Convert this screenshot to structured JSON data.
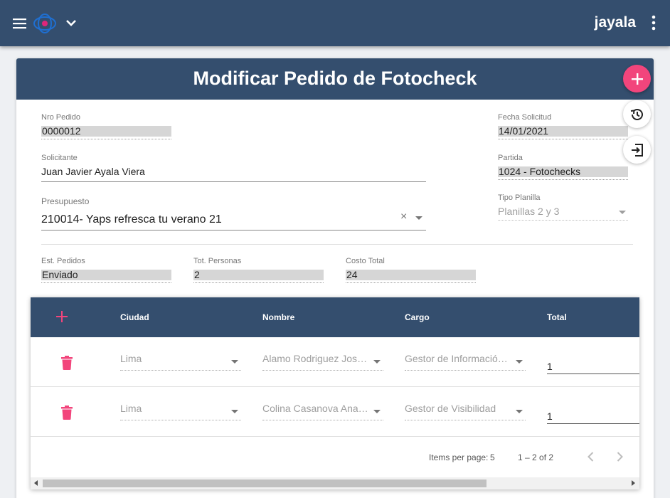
{
  "header": {
    "username": "jayala",
    "icons": [
      "menu-icon",
      "logo-icon",
      "chevron-down-icon",
      "more-vert-icon"
    ]
  },
  "form": {
    "title": "Modificar Pedido de Fotocheck",
    "nro_pedido": {
      "label": "Nro Pedido",
      "value": "0000012"
    },
    "fecha_solicitud": {
      "label": "Fecha Solicitud",
      "value": "14/01/2021"
    },
    "solicitante": {
      "label": "Solicitante",
      "value": "Juan Javier Ayala Viera"
    },
    "partida": {
      "label": "Partida",
      "value": "1024 - Fotochecks"
    },
    "presupuesto": {
      "label": "Presupuesto",
      "value": "210014- Yaps refresca tu verano 21",
      "clear": "×"
    },
    "tipo_planilla": {
      "label": "Tipo Planilla",
      "value": "Planillas 2 y 3"
    },
    "est_pedidos": {
      "label": "Est. Pedidos",
      "value": "Enviado"
    },
    "tot_personas": {
      "label": "Tot. Personas",
      "value": "2"
    },
    "costo_total": {
      "label": "Costo Total",
      "value": "24"
    }
  },
  "table": {
    "columns": [
      "Ciudad",
      "Nombre",
      "Cargo",
      "Total"
    ],
    "rows": [
      {
        "ciudad": "Lima",
        "nombre": "Alamo Rodriguez Jose…",
        "cargo": "Gestor de Información …",
        "total": "1"
      },
      {
        "ciudad": "Lima",
        "nombre": "Colina Casanova Ana …",
        "cargo": "Gestor de Visibilidad",
        "total": "1"
      }
    ],
    "paginator": {
      "items_per_page_label": "Items per page:",
      "page_size": "5",
      "range": "1 – 2 of 2"
    }
  },
  "colors": {
    "primary": "#344e6e",
    "accent": "#f2457c"
  }
}
